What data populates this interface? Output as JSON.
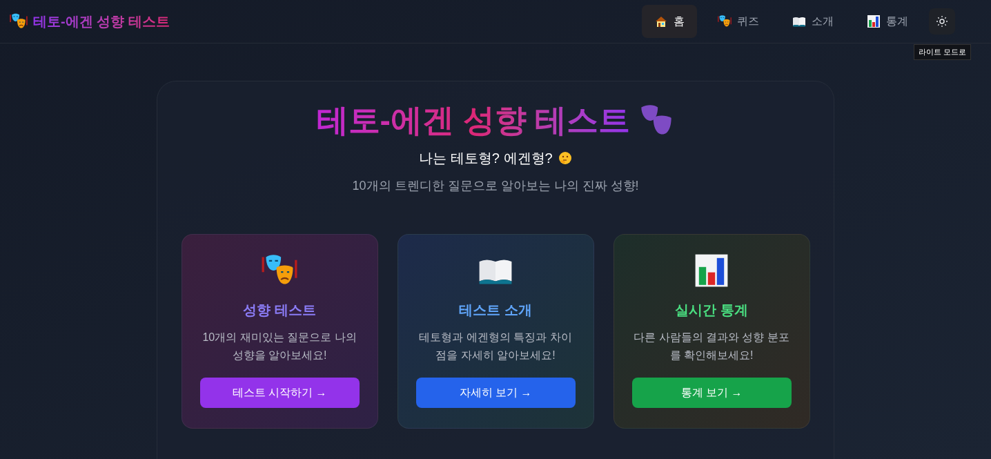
{
  "header": {
    "logo": "테토-에겐 성향 테스트"
  },
  "nav": [
    {
      "kind": "home",
      "label": "홈",
      "selected": true
    },
    {
      "kind": "quiz",
      "label": "퀴즈",
      "selected": false
    },
    {
      "kind": "about",
      "label": "소개",
      "selected": false
    },
    {
      "kind": "stats",
      "label": "통계",
      "selected": false
    }
  ],
  "theme_toggle": {
    "tooltip": "라이트 모드로"
  },
  "hero": {
    "title": "테토-에겐 성향 테스트",
    "subtitle": "나는 테토형? 에겐형?",
    "description": "10개의 트렌디한 질문으로 알아보는 나의 진짜 성향!"
  },
  "cards": [
    {
      "kind": "quiz",
      "title": "성향 테스트",
      "text": "10개의 재미있는 질문으로 나의 성향을 알아보세요!",
      "button": "테스트 시작하기 →"
    },
    {
      "kind": "about",
      "title": "테스트 소개",
      "text": "테토형과 에겐형의 특징과 차이점을 자세히 알아보세요!",
      "button": "자세히 보기 →"
    },
    {
      "kind": "stats",
      "title": "실시간 통계",
      "text": "다른 사람들의 결과와 성향 분포를 확인해보세요!",
      "button": "통계 보기 →"
    }
  ]
}
